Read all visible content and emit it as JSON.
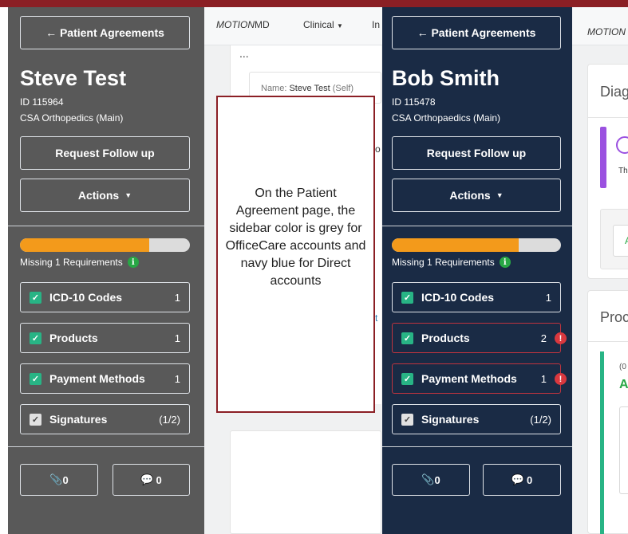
{
  "left_panel": {
    "back_label": "← Patient Agreements",
    "patient_name": "Steve Test",
    "patient_id": "ID 115964",
    "clinic": "CSA Orthopedics (Main)",
    "follow_up_label": "Request Follow up",
    "actions_label": "Actions",
    "progress_fraction": 0.76,
    "missing_text": "Missing 1 Requirements",
    "requirements": [
      {
        "label": "ICD-10 Codes",
        "count": "1"
      },
      {
        "label": "Products",
        "count": "1"
      },
      {
        "label": "Payment Methods",
        "count": "1"
      },
      {
        "label": "Signatures",
        "count": "(1/2)"
      }
    ],
    "attachments_count": "0",
    "comments_count": "0"
  },
  "middle": {
    "brand_prefix": "MOTION",
    "brand_suffix": "MD",
    "nav_clinical": "Clinical",
    "nav_peek": "In",
    "card_title_peek": "...",
    "name_label": "Name:",
    "name_value": "Steve Test",
    "name_suffix": "(Self)",
    "peek_o": "o",
    "peek_link": "t"
  },
  "callout": {
    "text": "On the Patient Agreement page, the sidebar color is grey for OfficeCare accounts and navy blue for Direct accounts"
  },
  "right_panel": {
    "back_label": "← Patient Agreements",
    "patient_name": "Bob Smith",
    "patient_id": "ID 115478",
    "clinic": "CSA Orthopaedics (Main)",
    "follow_up_label": "Request Follow up",
    "actions_label": "Actions",
    "progress_fraction": 0.75,
    "missing_text": "Missing 1 Requirements",
    "requirements": [
      {
        "label": "ICD-10 Codes",
        "count": "1"
      },
      {
        "label": "Products",
        "count": "2"
      },
      {
        "label": "Payment Methods",
        "count": "1"
      },
      {
        "label": "Signatures",
        "count": "(1/2)"
      }
    ],
    "attachments_count": "0",
    "comments_count": "0"
  },
  "right_content": {
    "brand_peek": "MOTION",
    "card1_title": "Diag",
    "card1_text": "Th",
    "green_button_peek": "A",
    "card2_title": "Proc",
    "item_small": "(0",
    "item_big": "A"
  },
  "colors": {
    "grey_sidebar": "#595959",
    "navy_sidebar": "#1a2b45",
    "progress_orange": "#f39a1b",
    "check_green": "#28b485",
    "warning_red": "#d9383e",
    "callout_border": "#8b1f25"
  },
  "icons": {
    "arrow": "left-arrow-icon",
    "caret": "caret-down-icon",
    "info": "info-icon",
    "check": "checkbox-checked-icon",
    "warning": "exclamation-icon",
    "paperclip": "paperclip-icon",
    "comment": "comment-icon"
  }
}
